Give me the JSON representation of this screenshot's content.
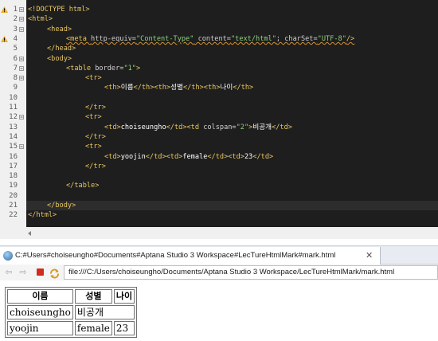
{
  "editor": {
    "lines": [
      {
        "num": "1",
        "indent": 0,
        "warn": true,
        "fold": true,
        "parts": [
          {
            "c": "t-doc",
            "t": "<!DOCTYPE html>"
          }
        ]
      },
      {
        "num": "2",
        "indent": 0,
        "warn": false,
        "fold": true,
        "parts": [
          {
            "c": "t-tag",
            "t": "<html>"
          }
        ]
      },
      {
        "num": "3",
        "indent": 1,
        "warn": false,
        "fold": true,
        "parts": [
          {
            "c": "t-tag",
            "t": "<head>"
          }
        ]
      },
      {
        "num": "4",
        "indent": 2,
        "warn": true,
        "fold": false,
        "squig": true,
        "parts": [
          {
            "c": "t-tag",
            "t": "<meta "
          },
          {
            "c": "t-attr",
            "t": "http-equiv="
          },
          {
            "c": "t-str",
            "t": "\"Content-Type\""
          },
          {
            "c": "t-attr",
            "t": " content="
          },
          {
            "c": "t-str",
            "t": "\"text/html\""
          },
          {
            "c": "t-attr",
            "t": "; charSet="
          },
          {
            "c": "t-str",
            "t": "\"UTF-8\""
          },
          {
            "c": "t-tag",
            "t": "/>"
          }
        ]
      },
      {
        "num": "5",
        "indent": 1,
        "warn": false,
        "fold": false,
        "parts": [
          {
            "c": "t-tag",
            "t": "</head>"
          }
        ]
      },
      {
        "num": "6",
        "indent": 1,
        "warn": false,
        "fold": true,
        "parts": [
          {
            "c": "t-tag",
            "t": "<body>"
          }
        ]
      },
      {
        "num": "7",
        "indent": 2,
        "warn": false,
        "fold": true,
        "parts": [
          {
            "c": "t-tag",
            "t": "<table "
          },
          {
            "c": "t-attr",
            "t": "border="
          },
          {
            "c": "t-str",
            "t": "\"1\""
          },
          {
            "c": "t-tag",
            "t": ">"
          }
        ]
      },
      {
        "num": "8",
        "indent": 3,
        "warn": false,
        "fold": true,
        "parts": [
          {
            "c": "t-tag",
            "t": "<tr>"
          }
        ]
      },
      {
        "num": "9",
        "indent": 4,
        "warn": false,
        "fold": false,
        "parts": [
          {
            "c": "t-tag",
            "t": "<th>"
          },
          {
            "c": "t-text",
            "t": "이름"
          },
          {
            "c": "t-tag",
            "t": "</th><th>"
          },
          {
            "c": "t-text",
            "t": "성별"
          },
          {
            "c": "t-tag",
            "t": "</th><th>"
          },
          {
            "c": "t-text",
            "t": "나이"
          },
          {
            "c": "t-tag",
            "t": "</th>"
          }
        ]
      },
      {
        "num": "10",
        "indent": 0,
        "warn": false,
        "fold": false,
        "parts": []
      },
      {
        "num": "11",
        "indent": 3,
        "warn": false,
        "fold": false,
        "parts": [
          {
            "c": "t-tag",
            "t": "</tr>"
          }
        ]
      },
      {
        "num": "12",
        "indent": 3,
        "warn": false,
        "fold": true,
        "parts": [
          {
            "c": "t-tag",
            "t": "<tr>"
          }
        ]
      },
      {
        "num": "13",
        "indent": 4,
        "warn": false,
        "fold": false,
        "parts": [
          {
            "c": "t-tag",
            "t": "<td>"
          },
          {
            "c": "t-text",
            "t": "choiseungho"
          },
          {
            "c": "t-tag",
            "t": "</td><td "
          },
          {
            "c": "t-attr",
            "t": "colspan="
          },
          {
            "c": "t-str",
            "t": "\"2\""
          },
          {
            "c": "t-tag",
            "t": ">"
          },
          {
            "c": "t-text",
            "t": "비공개"
          },
          {
            "c": "t-tag",
            "t": "</td>"
          }
        ]
      },
      {
        "num": "14",
        "indent": 3,
        "warn": false,
        "fold": false,
        "parts": [
          {
            "c": "t-tag",
            "t": "</tr>"
          }
        ]
      },
      {
        "num": "15",
        "indent": 3,
        "warn": false,
        "fold": true,
        "parts": [
          {
            "c": "t-tag",
            "t": "<tr>"
          }
        ]
      },
      {
        "num": "16",
        "indent": 4,
        "warn": false,
        "fold": false,
        "parts": [
          {
            "c": "t-tag",
            "t": "<td>"
          },
          {
            "c": "t-text",
            "t": "yoojin"
          },
          {
            "c": "t-tag",
            "t": "</td><td>"
          },
          {
            "c": "t-text",
            "t": "female"
          },
          {
            "c": "t-tag",
            "t": "</td><td>"
          },
          {
            "c": "t-text",
            "t": "23"
          },
          {
            "c": "t-tag",
            "t": "</td>"
          }
        ]
      },
      {
        "num": "17",
        "indent": 3,
        "warn": false,
        "fold": false,
        "parts": [
          {
            "c": "t-tag",
            "t": "</tr>"
          }
        ]
      },
      {
        "num": "18",
        "indent": 0,
        "warn": false,
        "fold": false,
        "parts": []
      },
      {
        "num": "19",
        "indent": 2,
        "warn": false,
        "fold": false,
        "parts": [
          {
            "c": "t-tag",
            "t": "</table>"
          }
        ]
      },
      {
        "num": "20",
        "indent": 0,
        "warn": false,
        "fold": false,
        "parts": []
      },
      {
        "num": "21",
        "indent": 1,
        "warn": false,
        "fold": false,
        "current": true,
        "parts": [
          {
            "c": "t-tag",
            "t": "</body>"
          }
        ]
      },
      {
        "num": "22",
        "indent": 0,
        "warn": false,
        "fold": false,
        "parts": [
          {
            "c": "t-tag",
            "t": "</html>"
          }
        ]
      }
    ]
  },
  "browser": {
    "tab_title": "C:#Users#choiseungho#Documents#Aptana Studio 3 Workspace#LecTureHtmlMark#mark.html",
    "tab_close": "✕",
    "back_icon": "back-arrow-icon",
    "forward_icon": "forward-arrow-icon",
    "stop_icon": "stop-icon",
    "refresh_icon": "refresh-icon",
    "url": "file:///C:/Users/choiseungho/Documents/Aptana Studio 3 Workspace/LecTureHtmlMark/mark.html"
  },
  "rendered_table": {
    "headers": [
      "이름",
      "성별",
      "나이"
    ],
    "row1": {
      "name": "choiseungho",
      "merged": "비공개"
    },
    "row2": {
      "name": "yoojin",
      "gender": "female",
      "age": "23"
    }
  },
  "colors": {
    "editor_bg": "#1e1e1e",
    "tag": "#e8c662",
    "string": "#8fcf7f",
    "warning": "#f0b020",
    "stop": "#d42a1e"
  }
}
